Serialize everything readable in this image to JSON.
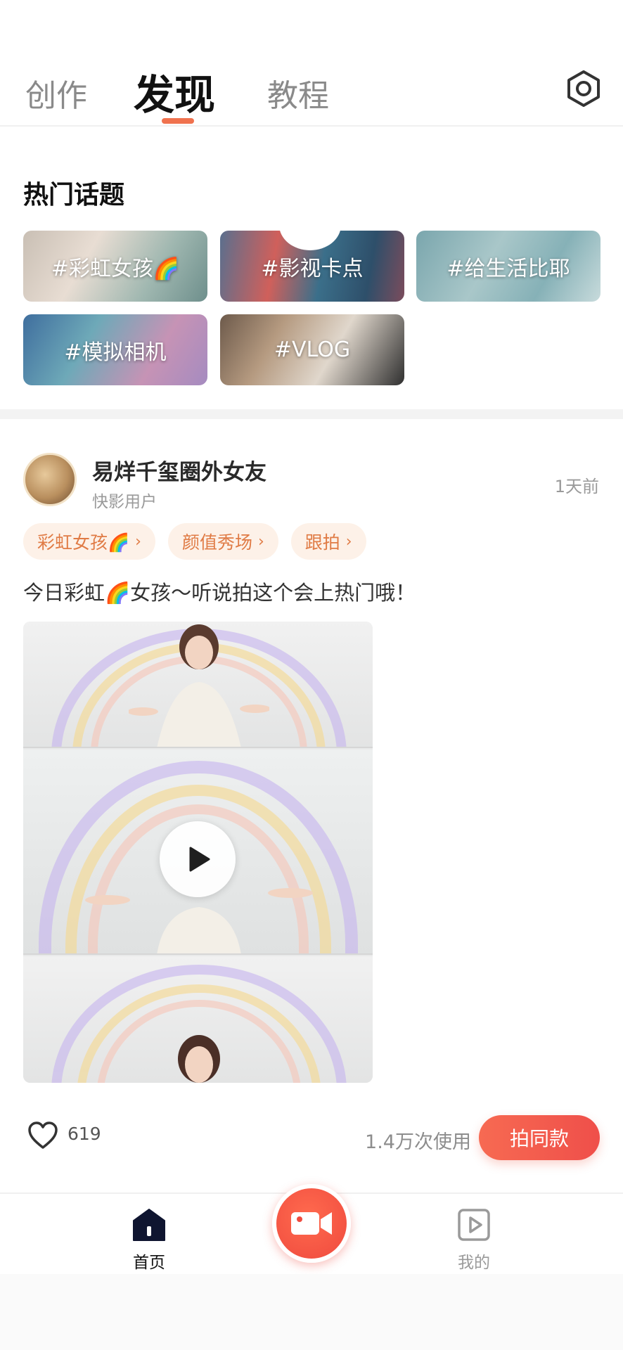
{
  "header": {
    "tabs": [
      {
        "label": "创作",
        "active": false
      },
      {
        "label": "发现",
        "active": true
      },
      {
        "label": "教程",
        "active": false
      }
    ],
    "settings_icon": "settings-hexagon-icon",
    "accent_color": "#f0724e"
  },
  "hot_topics": {
    "title": "热门话题",
    "items": [
      {
        "label": "#彩虹女孩🌈"
      },
      {
        "label": "#影视卡点"
      },
      {
        "label": "#给生活比耶"
      },
      {
        "label": "#模拟相机"
      },
      {
        "label": "#VLOG"
      }
    ]
  },
  "post": {
    "username": "易烊千玺圈外女友",
    "subtitle": "快影用户",
    "time": "1天前",
    "tags": [
      {
        "label": "彩虹女孩🌈"
      },
      {
        "label": "颜值秀场"
      },
      {
        "label": "跟拍"
      }
    ],
    "caption": "今日彩虹🌈女孩～听说拍这个会上热门哦！",
    "like_count": "619",
    "usage": "1.4万次使用",
    "shoot_same_label": "拍同款",
    "tag_color": "#e07b45",
    "button_color": "#ef4f4a"
  },
  "bottom_nav": {
    "home_label": "首页",
    "mine_label": "我的",
    "record_icon": "video-camera-icon"
  }
}
